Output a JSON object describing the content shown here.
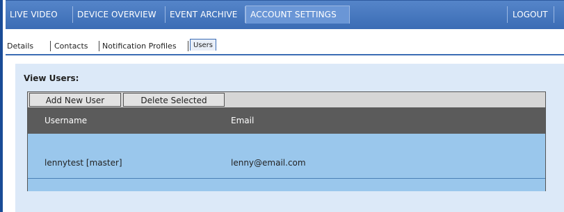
{
  "topnav": {
    "tabs": [
      {
        "label": "LIVE VIDEO"
      },
      {
        "label": "DEVICE OVERVIEW"
      },
      {
        "label": "EVENT ARCHIVE"
      },
      {
        "label": "ACCOUNT SETTINGS"
      }
    ],
    "active_tab": "ACCOUNT SETTINGS",
    "logout_label": "LOGOUT"
  },
  "subnav": {
    "tabs": [
      {
        "label": "Details"
      },
      {
        "label": "Contacts"
      },
      {
        "label": "Notification Profiles"
      },
      {
        "label": "Users"
      }
    ],
    "active_tab": "Users"
  },
  "panel": {
    "title": "View Users:"
  },
  "users_table": {
    "buttons": {
      "add": "Add New User",
      "delete": "Delete Selected"
    },
    "columns": [
      "Username",
      "Email"
    ],
    "rows": [
      {
        "username": "lennytest [master]",
        "email": "lenny@email.com"
      }
    ]
  },
  "colors": {
    "nav_bar": "#3a6bb4",
    "panel_bg": "#dce9f8",
    "table_header": "#5b5b5b",
    "table_row": "#9ac7ec"
  }
}
